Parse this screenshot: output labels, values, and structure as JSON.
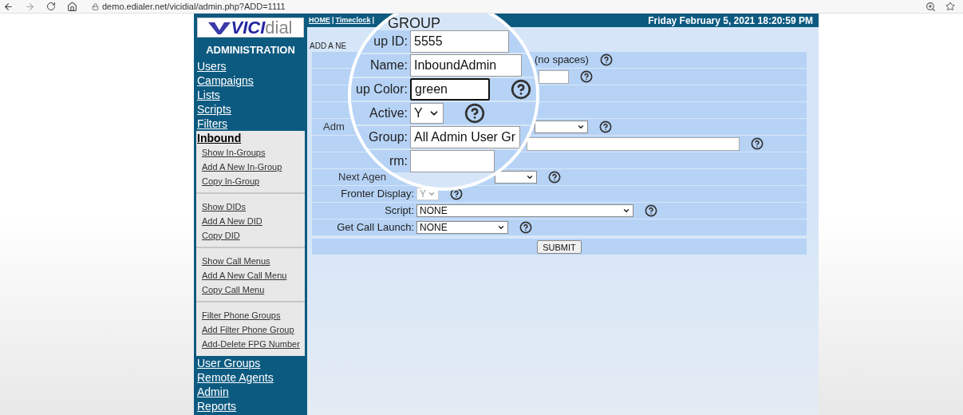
{
  "browser": {
    "url": "demo.edialer.net/vicidial/admin.php?ADD=1111"
  },
  "header": {
    "items": [
      {
        "kind": "link",
        "text": "HOME"
      },
      {
        "kind": "separator",
        "text": "|"
      },
      {
        "kind": "link",
        "text": "Timeclock"
      },
      {
        "kind": "separator",
        "text": "|"
      }
    ],
    "datetime": "Friday February 5, 2021 18:20:59 PM"
  },
  "sidebar": {
    "logo": {
      "part_1": "VICI",
      "part_2": "dial"
    },
    "title": "ADMINISTRATION",
    "items": [
      {
        "label": "Users",
        "expanded": false
      },
      {
        "label": "Campaigns",
        "expanded": false
      },
      {
        "label": "Lists",
        "expanded": false
      },
      {
        "label": "Scripts",
        "expanded": false
      },
      {
        "label": "Filters",
        "expanded": false
      },
      {
        "label": "Inbound",
        "expanded": true,
        "sections": [
          [
            "Show In-Groups",
            "Add A New In-Group",
            "Copy In-Group"
          ],
          [
            "Show DIDs",
            "Add A New DID",
            "Copy DID"
          ],
          [
            "Show Call Menus",
            "Add A New Call Menu",
            "Copy Call Menu"
          ],
          [
            "Filter Phone Groups",
            "Add Filter Phone Group",
            "Add-Delete FPG Number"
          ]
        ]
      },
      {
        "label": "User Groups",
        "expanded": false
      },
      {
        "label": "Remote Agents",
        "expanded": false
      },
      {
        "label": "Admin",
        "expanded": false
      },
      {
        "label": "Reports",
        "expanded": false
      }
    ]
  },
  "form": {
    "heading": "ADD A NE",
    "rows": [
      {
        "kind": "note",
        "note": "(no spaces)"
      },
      {
        "kind": "input"
      },
      {
        "kind": "blank"
      },
      {
        "kind": "blank"
      },
      {
        "kind": "select",
        "label": "Adm",
        "cut": true
      },
      {
        "kind": "input"
      },
      {
        "kind": "blank"
      },
      {
        "kind": "select",
        "label": "Next Agen",
        "cut": true
      },
      {
        "kind": "select",
        "label": "Fronter Display:",
        "cut": false,
        "value": "Y",
        "disabled": true
      },
      {
        "kind": "select",
        "label": "Script:",
        "cut": false,
        "value": "NONE",
        "disabled": false
      },
      {
        "kind": "select",
        "label": "Get Call Launch:",
        "cut": false,
        "value": "NONE",
        "disabled": false
      }
    ],
    "submit": "SUBMIT"
  },
  "magnifier": {
    "heading": "GROUP",
    "rows": [
      {
        "kind": "input",
        "label": "up ID:",
        "value": "5555",
        "focused": false
      },
      {
        "kind": "input",
        "label": "Name:",
        "value": "InboundAdmin",
        "focused": false
      },
      {
        "kind": "input",
        "label": "up Color:",
        "value": "green",
        "focused": true
      },
      {
        "kind": "select",
        "label": "Active:",
        "value": "Y"
      },
      {
        "kind": "input",
        "label": "Group:",
        "value": "All Admin User Gr",
        "focused": false
      },
      {
        "kind": "input",
        "label": "rm:",
        "value": "",
        "focused": false
      }
    ]
  }
}
